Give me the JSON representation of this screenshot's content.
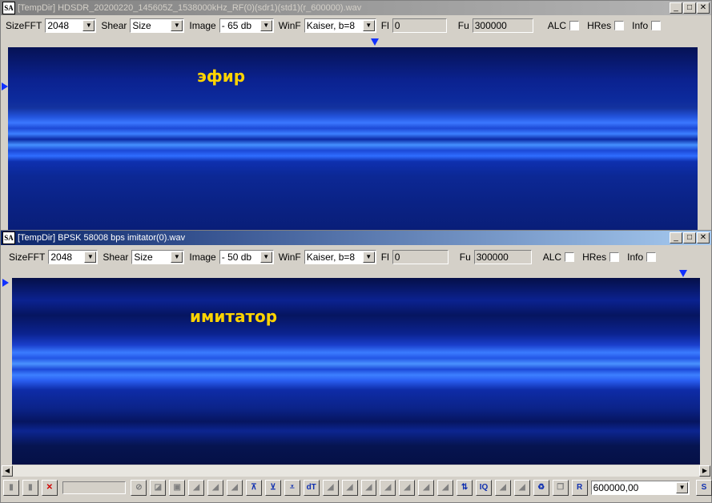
{
  "window1": {
    "title": "[TempDir] HDSDR_20200220_145605Z_1538000kHz_RF(0)(sdr1)(std1)(r_600000).wav",
    "overlay": "эфир"
  },
  "window2": {
    "title": "[TempDir] BPSK 58008 bps imitator(0).wav",
    "overlay": "имитатор"
  },
  "toolbar1": {
    "sizefft_label": "SizeFFT",
    "sizefft_value": "2048",
    "shear_label": "Shear",
    "shear_value": "Size",
    "image_label": "Image",
    "image_value": "- 65 db",
    "winf_label": "WinF",
    "winf_value": "Kaiser, b=8",
    "fl_label": "Fl",
    "fl_value": "0",
    "fu_label": "Fu",
    "fu_value": "300000",
    "alc_label": "ALC",
    "hres_label": "HRes",
    "info_label": "Info"
  },
  "toolbar2": {
    "sizefft_label": "SizeFFT",
    "sizefft_value": "2048",
    "shear_label": "Shear",
    "shear_value": "Size",
    "image_label": "Image",
    "image_value": "- 50 db",
    "winf_label": "WinF",
    "winf_value": "Kaiser, b=8",
    "fl_label": "Fl",
    "fl_value": "0",
    "fu_label": "Fu",
    "fu_value": "300000",
    "alc_label": "ALC",
    "hres_label": "HRes",
    "info_label": "Info"
  },
  "caption_buttons": {
    "minimize": "_",
    "maximize": "□",
    "close": "✕"
  },
  "bottom": {
    "frequency_value": "600000,00",
    "s_button": "S",
    "r_button": "R",
    "dt_button": "dT",
    "iq_button": "IQ"
  },
  "colors": {
    "spectrum_bg": "#081a6e",
    "band": "#2f6dff",
    "overlay_text": "#ffd400",
    "marker": "#1030ff"
  }
}
